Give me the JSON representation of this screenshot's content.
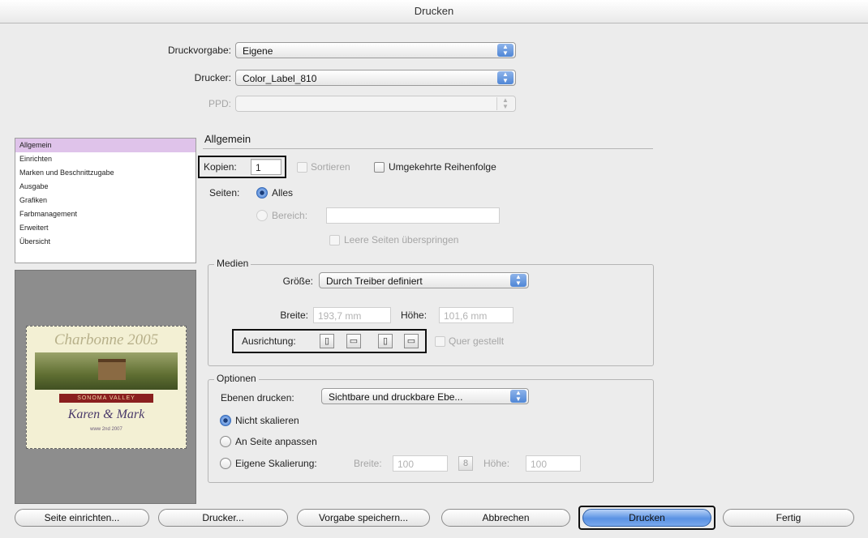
{
  "window": {
    "title": "Drucken"
  },
  "top": {
    "preset_label": "Druckvorgabe:",
    "preset_value": "Eigene",
    "printer_label": "Drucker:",
    "printer_value": "Color_Label_810",
    "ppd_label": "PPD:",
    "ppd_value": ""
  },
  "categories": [
    {
      "label": "Allgemein",
      "selected": true
    },
    {
      "label": "Einrichten"
    },
    {
      "label": "Marken und Beschnittzugabe"
    },
    {
      "label": "Ausgabe"
    },
    {
      "label": "Grafiken"
    },
    {
      "label": "Farbmanagement"
    },
    {
      "label": "Erweitert"
    },
    {
      "label": "Übersicht"
    }
  ],
  "general": {
    "section_title": "Allgemein",
    "copies_label": "Kopien:",
    "copies_value": "1",
    "collate_label": "Sortieren",
    "reverse_label": "Umgekehrte Reihenfolge",
    "pages_label": "Seiten:",
    "all_label": "Alles",
    "range_label": "Bereich:",
    "range_value": "",
    "skip_blank_label": "Leere Seiten überspringen"
  },
  "media": {
    "group_label": "Medien",
    "size_label": "Größe:",
    "size_value": "Durch Treiber definiert",
    "width_label": "Breite:",
    "width_value": "193,7 mm",
    "height_label": "Höhe:",
    "height_value": "101,6 mm",
    "orientation_label": "Ausrichtung:",
    "transverse_label": "Quer gestellt"
  },
  "options": {
    "group_label": "Optionen",
    "layers_label": "Ebenen drucken:",
    "layers_value": "Sichtbare und druckbare Ebe...",
    "no_scale_label": "Nicht skalieren",
    "fit_label": "An Seite anpassen",
    "custom_scale_label": "Eigene Skalierung:",
    "scale_width_label": "Breite:",
    "scale_width_value": "100",
    "scale_height_label": "Höhe:",
    "scale_height_value": "100"
  },
  "preview": {
    "title": "Charbonne 2005",
    "banner": "SONOMA VALLEY",
    "names": "Karen & Mark",
    "date": "www 2nd 2007"
  },
  "buttons": {
    "page_setup": "Seite einrichten...",
    "printer": "Drucker...",
    "save_preset": "Vorgabe speichern...",
    "cancel": "Abbrechen",
    "print": "Drucken",
    "done": "Fertig"
  },
  "colors": {
    "selection": "#dfc3ea",
    "accent": "#5a92e3",
    "dialog_bg": "#ececec"
  }
}
